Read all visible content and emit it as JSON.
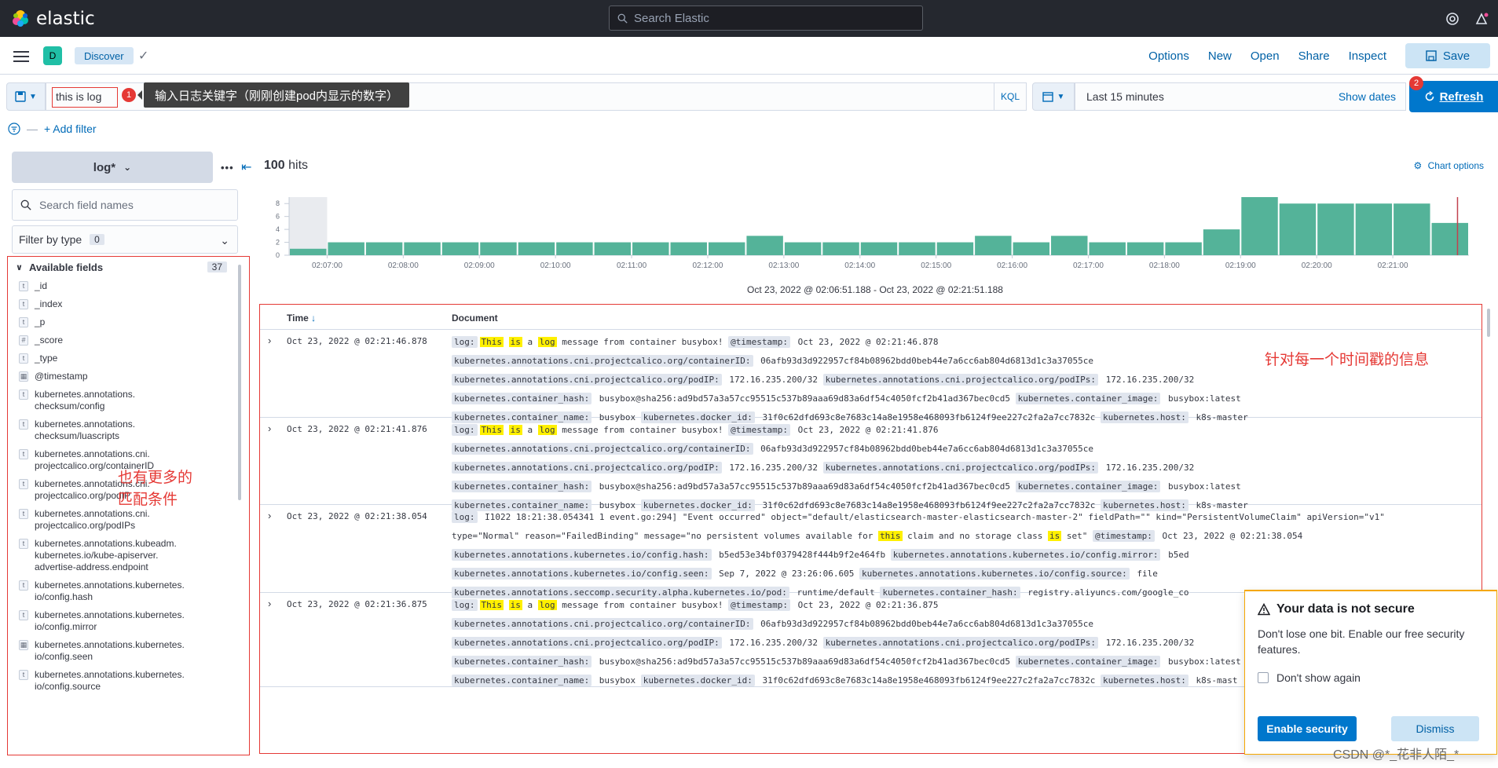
{
  "topbar": {
    "brand": "elastic",
    "search_placeholder": "Search Elastic"
  },
  "app": {
    "space_initial": "D",
    "breadcrumb": "Discover",
    "nav": [
      "Options",
      "New",
      "Open",
      "Share",
      "Inspect"
    ],
    "save_label": "Save"
  },
  "query": {
    "value": "this is log",
    "language": "KQL",
    "badge1": "1",
    "tooltip": "输入日志关键字（刚刚创建pod内显示的数字）"
  },
  "time": {
    "range": "Last 15 minutes",
    "show_dates": "Show dates",
    "refresh": "Refresh",
    "badge2": "2"
  },
  "filter": {
    "add": "+ Add filter"
  },
  "sidebar": {
    "index_pattern": "log*",
    "field_search_placeholder": "Search field names",
    "filter_by_type": "Filter by type",
    "filter_count": "0",
    "available_fields": "Available fields",
    "available_count": "37",
    "fields": [
      {
        "type": "t",
        "name": "_id"
      },
      {
        "type": "t",
        "name": "_index"
      },
      {
        "type": "t",
        "name": "_p"
      },
      {
        "type": "#",
        "name": "_score"
      },
      {
        "type": "t",
        "name": "_type"
      },
      {
        "type": "d",
        "name": "@timestamp"
      },
      {
        "type": "t",
        "name": "kubernetes.annotations.\nchecksum/config"
      },
      {
        "type": "t",
        "name": "kubernetes.annotations.\nchecksum/luascripts"
      },
      {
        "type": "t",
        "name": "kubernetes.annotations.cni.\nprojectcalico.org/containerID"
      },
      {
        "type": "t",
        "name": "kubernetes.annotations.cni.\nprojectcalico.org/podIP"
      },
      {
        "type": "t",
        "name": "kubernetes.annotations.cni.\nprojectcalico.org/podIPs"
      },
      {
        "type": "t",
        "name": "kubernetes.annotations.kubeadm.\nkubernetes.io/kube-apiserver.\nadvertise-address.endpoint"
      },
      {
        "type": "t",
        "name": "kubernetes.annotations.kubernetes.\nio/config.hash"
      },
      {
        "type": "t",
        "name": "kubernetes.annotations.kubernetes.\nio/config.mirror"
      },
      {
        "type": "d",
        "name": "kubernetes.annotations.kubernetes.\nio/config.seen"
      },
      {
        "type": "t",
        "name": "kubernetes.annotations.kubernetes.\nio/config.source"
      }
    ],
    "annotation": "也有更多的\n匹配条件"
  },
  "main": {
    "hits_count": "100",
    "hits_label": "hits",
    "chart_options": "Chart options",
    "range_label": "Oct 23, 2022 @ 02:06:51.188 - Oct 23, 2022 @ 02:21:51.188",
    "col_time": "Time",
    "col_document": "Document",
    "annotation": "针对每一个时间戳的信息"
  },
  "chart_data": {
    "type": "bar",
    "title": "",
    "xlabel": "",
    "ylabel": "",
    "ylim": [
      0,
      9
    ],
    "yticks": [
      0,
      2,
      4,
      6,
      8
    ],
    "xticks": [
      "02:07:00",
      "02:08:00",
      "02:09:00",
      "02:10:00",
      "02:11:00",
      "02:12:00",
      "02:13:00",
      "02:14:00",
      "02:15:00",
      "02:16:00",
      "02:17:00",
      "02:18:00",
      "02:19:00",
      "02:20:00",
      "02:21:00"
    ],
    "x": [
      "02:06:30",
      "02:07:00",
      "02:07:30",
      "02:08:00",
      "02:08:30",
      "02:09:00",
      "02:09:30",
      "02:10:00",
      "02:10:30",
      "02:11:00",
      "02:11:30",
      "02:12:00",
      "02:12:30",
      "02:13:00",
      "02:13:30",
      "02:14:00",
      "02:14:30",
      "02:15:00",
      "02:15:30",
      "02:16:00",
      "02:16:30",
      "02:17:00",
      "02:17:30",
      "02:18:00",
      "02:18:30",
      "02:19:00",
      "02:19:30",
      "02:20:00",
      "02:20:30",
      "02:21:00",
      "02:21:30"
    ],
    "values": [
      1,
      2,
      2,
      2,
      2,
      2,
      2,
      2,
      2,
      2,
      2,
      2,
      3,
      2,
      2,
      2,
      2,
      2,
      3,
      2,
      3,
      2,
      2,
      2,
      4,
      9,
      8,
      8,
      8,
      8,
      5
    ],
    "color": "#54b399"
  },
  "documents": [
    {
      "time": "Oct 23, 2022 @ 02:21:46.878",
      "lines": [
        [
          [
            "k",
            "log:"
          ],
          [
            "hl",
            "This"
          ],
          [
            "t",
            " "
          ],
          [
            "hl",
            "is"
          ],
          [
            "t",
            " a "
          ],
          [
            "hl",
            "log"
          ],
          [
            "t",
            " message from container busybox! "
          ],
          [
            "k",
            "@timestamp:"
          ],
          [
            "t",
            " Oct 23, 2022 @ 02:21:46.878"
          ]
        ],
        [
          [
            "k",
            "kubernetes.annotations.cni.projectcalico.org/containerID:"
          ],
          [
            "t",
            " 06afb93d3d922957cf84b08962bdd0beb44e7a6cc6ab804d6813d1c3a37055ce"
          ]
        ],
        [
          [
            "k",
            "kubernetes.annotations.cni.projectcalico.org/podIP:"
          ],
          [
            "t",
            " 172.16.235.200/32 "
          ],
          [
            "k",
            "kubernetes.annotations.cni.projectcalico.org/podIPs:"
          ],
          [
            "t",
            " 172.16.235.200/32"
          ]
        ],
        [
          [
            "k",
            "kubernetes.container_hash:"
          ],
          [
            "t",
            " busybox@sha256:ad9bd57a3a57cc95515c537b89aaa69d83a6df54c4050fcf2b41ad367bec0cd5 "
          ],
          [
            "k",
            "kubernetes.container_image:"
          ],
          [
            "t",
            " busybox:latest"
          ]
        ],
        [
          [
            "k",
            "kubernetes.container_name:"
          ],
          [
            "t",
            " busybox "
          ],
          [
            "k",
            "kubernetes.docker_id:"
          ],
          [
            "t",
            " 31f0c62dfd693c8e7683c14a8e1958e468093fb6124f9ee227c2fa2a7cc7832c "
          ],
          [
            "k",
            "kubernetes.host:"
          ],
          [
            "t",
            " k8s-master"
          ]
        ]
      ]
    },
    {
      "time": "Oct 23, 2022 @ 02:21:41.876",
      "lines": [
        [
          [
            "k",
            "log:"
          ],
          [
            "hl",
            "This"
          ],
          [
            "t",
            " "
          ],
          [
            "hl",
            "is"
          ],
          [
            "t",
            " a "
          ],
          [
            "hl",
            "log"
          ],
          [
            "t",
            " message from container busybox! "
          ],
          [
            "k",
            "@timestamp:"
          ],
          [
            "t",
            " Oct 23, 2022 @ 02:21:41.876"
          ]
        ],
        [
          [
            "k",
            "kubernetes.annotations.cni.projectcalico.org/containerID:"
          ],
          [
            "t",
            " 06afb93d3d922957cf84b08962bdd0beb44e7a6cc6ab804d6813d1c3a37055ce"
          ]
        ],
        [
          [
            "k",
            "kubernetes.annotations.cni.projectcalico.org/podIP:"
          ],
          [
            "t",
            " 172.16.235.200/32 "
          ],
          [
            "k",
            "kubernetes.annotations.cni.projectcalico.org/podIPs:"
          ],
          [
            "t",
            " 172.16.235.200/32"
          ]
        ],
        [
          [
            "k",
            "kubernetes.container_hash:"
          ],
          [
            "t",
            " busybox@sha256:ad9bd57a3a57cc95515c537b89aaa69d83a6df54c4050fcf2b41ad367bec0cd5 "
          ],
          [
            "k",
            "kubernetes.container_image:"
          ],
          [
            "t",
            " busybox:latest"
          ]
        ],
        [
          [
            "k",
            "kubernetes.container_name:"
          ],
          [
            "t",
            " busybox "
          ],
          [
            "k",
            "kubernetes.docker_id:"
          ],
          [
            "t",
            " 31f0c62dfd693c8e7683c14a8e1958e468093fb6124f9ee227c2fa2a7cc7832c "
          ],
          [
            "k",
            "kubernetes.host:"
          ],
          [
            "t",
            " k8s-master"
          ]
        ]
      ]
    },
    {
      "time": "Oct 23, 2022 @ 02:21:38.054",
      "lines": [
        [
          [
            "k",
            "log:"
          ],
          [
            "t",
            " I1022 18:21:38.054341 1 event.go:294] \"Event occurred\" object=\"default/elasticsearch-master-elasticsearch-master-2\" fieldPath=\"\" kind=\"PersistentVolumeClaim\" apiVersion=\"v1\""
          ]
        ],
        [
          [
            "t",
            "type=\"Normal\" reason=\"FailedBinding\" message=\"no persistent volumes available for "
          ],
          [
            "hl",
            "this"
          ],
          [
            "t",
            " claim and no storage class "
          ],
          [
            "hl",
            "is"
          ],
          [
            "t",
            " set\" "
          ],
          [
            "k",
            "@timestamp:"
          ],
          [
            "t",
            " Oct 23, 2022 @ 02:21:38.054"
          ]
        ],
        [
          [
            "k",
            "kubernetes.annotations.kubernetes.io/config.hash:"
          ],
          [
            "t",
            " b5ed53e34bf0379428f444b9f2e464fb "
          ],
          [
            "k",
            "kubernetes.annotations.kubernetes.io/config.mirror:"
          ],
          [
            "t",
            " b5ed"
          ]
        ],
        [
          [
            "k",
            "kubernetes.annotations.kubernetes.io/config.seen:"
          ],
          [
            "t",
            " Sep 7, 2022 @ 23:26:06.605 "
          ],
          [
            "k",
            "kubernetes.annotations.kubernetes.io/config.source:"
          ],
          [
            "t",
            " file"
          ]
        ],
        [
          [
            "k",
            "kubernetes.annotations.seccomp.security.alpha.kubernetes.io/pod:"
          ],
          [
            "t",
            " runtime/default "
          ],
          [
            "k",
            "kubernetes.container_hash:"
          ],
          [
            "t",
            " registry.aliyuncs.com/google_co"
          ]
        ]
      ]
    },
    {
      "time": "Oct 23, 2022 @ 02:21:36.875",
      "lines": [
        [
          [
            "k",
            "log:"
          ],
          [
            "hl",
            "This"
          ],
          [
            "t",
            " "
          ],
          [
            "hl",
            "is"
          ],
          [
            "t",
            " a "
          ],
          [
            "hl",
            "log"
          ],
          [
            "t",
            " message from container busybox! "
          ],
          [
            "k",
            "@timestamp:"
          ],
          [
            "t",
            " Oct 23, 2022 @ 02:21:36.875"
          ]
        ],
        [
          [
            "k",
            "kubernetes.annotations.cni.projectcalico.org/containerID:"
          ],
          [
            "t",
            " 06afb93d3d922957cf84b08962bdd0beb44e7a6cc6ab804d6813d1c3a37055ce"
          ]
        ],
        [
          [
            "k",
            "kubernetes.annotations.cni.projectcalico.org/podIP:"
          ],
          [
            "t",
            " 172.16.235.200/32 "
          ],
          [
            "k",
            "kubernetes.annotations.cni.projectcalico.org/podIPs:"
          ],
          [
            "t",
            " 172.16.235.200/32"
          ]
        ],
        [
          [
            "k",
            "kubernetes.container_hash:"
          ],
          [
            "t",
            " busybox@sha256:ad9bd57a3a57cc95515c537b89aaa69d83a6df54c4050fcf2b41ad367bec0cd5 "
          ],
          [
            "k",
            "kubernetes.container_image:"
          ],
          [
            "t",
            " busybox:latest"
          ]
        ],
        [
          [
            "k",
            "kubernetes.container_name:"
          ],
          [
            "t",
            " busybox "
          ],
          [
            "k",
            "kubernetes.docker_id:"
          ],
          [
            "t",
            " 31f0c62dfd693c8e7683c14a8e1958e468093fb6124f9ee227c2fa2a7cc7832c "
          ],
          [
            "k",
            "kubernetes.host:"
          ],
          [
            "t",
            " k8s-mast"
          ]
        ]
      ]
    }
  ],
  "toast": {
    "title": "Your data is not secure",
    "body": "Don't lose one bit. Enable our free security features.",
    "checkbox": "Don't show again",
    "enable": "Enable security",
    "dismiss": "Dismiss"
  },
  "watermark": "CSDN @*_花非人陌_*"
}
